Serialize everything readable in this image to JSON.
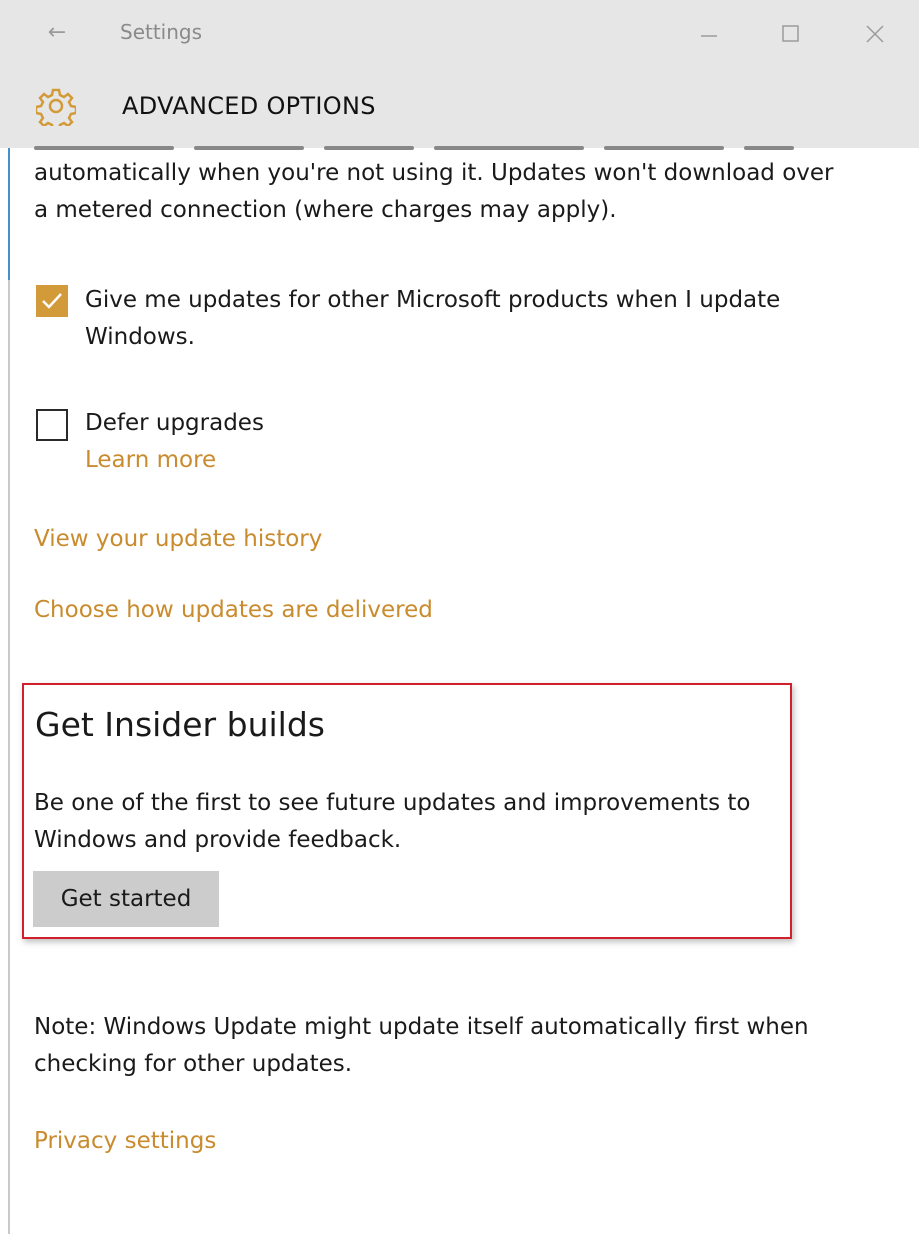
{
  "window": {
    "title": "Settings",
    "back_glyph": "←",
    "controls": {
      "minimize_icon": "minimize-icon",
      "maximize_icon": "maximize-icon",
      "close_icon": "close-icon"
    }
  },
  "header": {
    "icon": "gear-icon",
    "title": "ADVANCED OPTIONS"
  },
  "content": {
    "intro_text": "automatically when you're not using it. Updates won't download over a metered connection (where charges may apply).",
    "options": [
      {
        "label": "Give me updates for other Microsoft products when I update Windows.",
        "checked": true
      },
      {
        "label": "Defer upgrades",
        "checked": false,
        "link": "Learn more"
      }
    ],
    "links": {
      "update_history": "View your update history",
      "delivery": "Choose how updates are delivered"
    },
    "insider": {
      "title": "Get Insider builds",
      "description": "Be one of the first to see future updates and improvements to Windows and provide feedback.",
      "button_label": "Get started"
    },
    "note": "Note: Windows Update might update itself automatically first when checking for other updates.",
    "privacy_link": "Privacy settings"
  },
  "colors": {
    "accent": "#d39a3a",
    "link": "#c98b2e",
    "highlight_box": "#d11f2b",
    "header_background": "#e6e6e6"
  }
}
